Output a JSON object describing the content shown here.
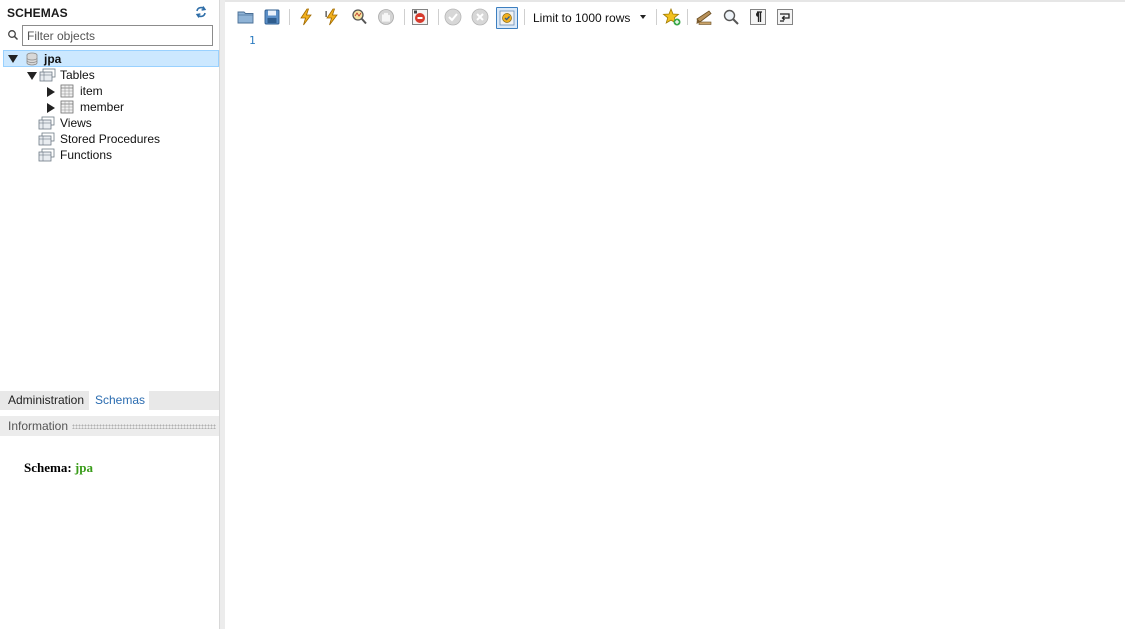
{
  "sidebar": {
    "title": "SCHEMAS",
    "filter_placeholder": "Filter objects",
    "tree": {
      "schema": "jpa",
      "tables_label": "Tables",
      "tables": [
        "item",
        "member"
      ],
      "views_label": "Views",
      "procedures_label": "Stored Procedures",
      "functions_label": "Functions"
    },
    "tabs": {
      "administration": "Administration",
      "schemas": "Schemas"
    },
    "info": {
      "title": "Information",
      "schema_label": "Schema:",
      "schema_value": "jpa"
    }
  },
  "toolbar": {
    "icons": [
      "open-file-icon",
      "save-icon",
      "execute-icon",
      "execute-current-icon",
      "explain-icon",
      "stop-icon",
      "toggle-error-stop-icon",
      "commit-icon",
      "rollback-icon",
      "autocommit-icon",
      "add-snippet-icon",
      "beautify-icon",
      "find-icon",
      "invisible-chars-icon",
      "word-wrap-icon"
    ],
    "limit_label": "Limit to 1000 rows"
  },
  "editor": {
    "line_numbers": [
      "1"
    ]
  },
  "colors": {
    "selection": "#cce8ff",
    "accent": "#2b6cb0",
    "schema_value": "#3a9c1a"
  }
}
